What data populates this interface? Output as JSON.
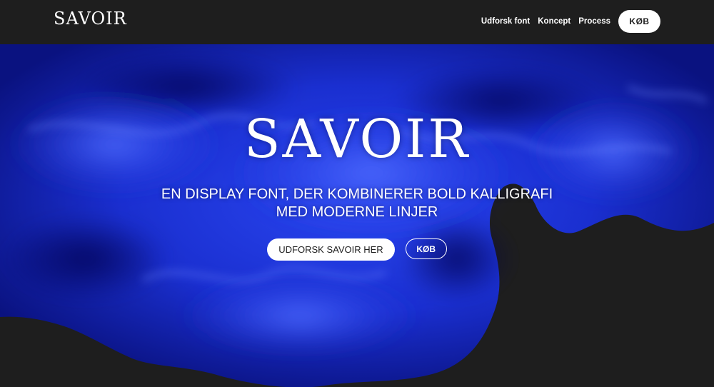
{
  "header": {
    "logo": "SAVOIR",
    "nav": [
      "Udforsk font",
      "Koncept",
      "Process"
    ],
    "buy_label": "KØB"
  },
  "hero": {
    "title": "SAVOIR",
    "subtitle_line1": "EN DISPLAY FONT, DER KOMBINERER BOLD KALLIGRAFI",
    "subtitle_line2": "MED MODERNE LINJER",
    "primary_cta": "UDFORSK SAVOIR HER",
    "secondary_cta": "KØB"
  },
  "colors": {
    "background": "#1e1e1e",
    "ink_blue": "#1a2fd0",
    "text": "#ffffff"
  }
}
